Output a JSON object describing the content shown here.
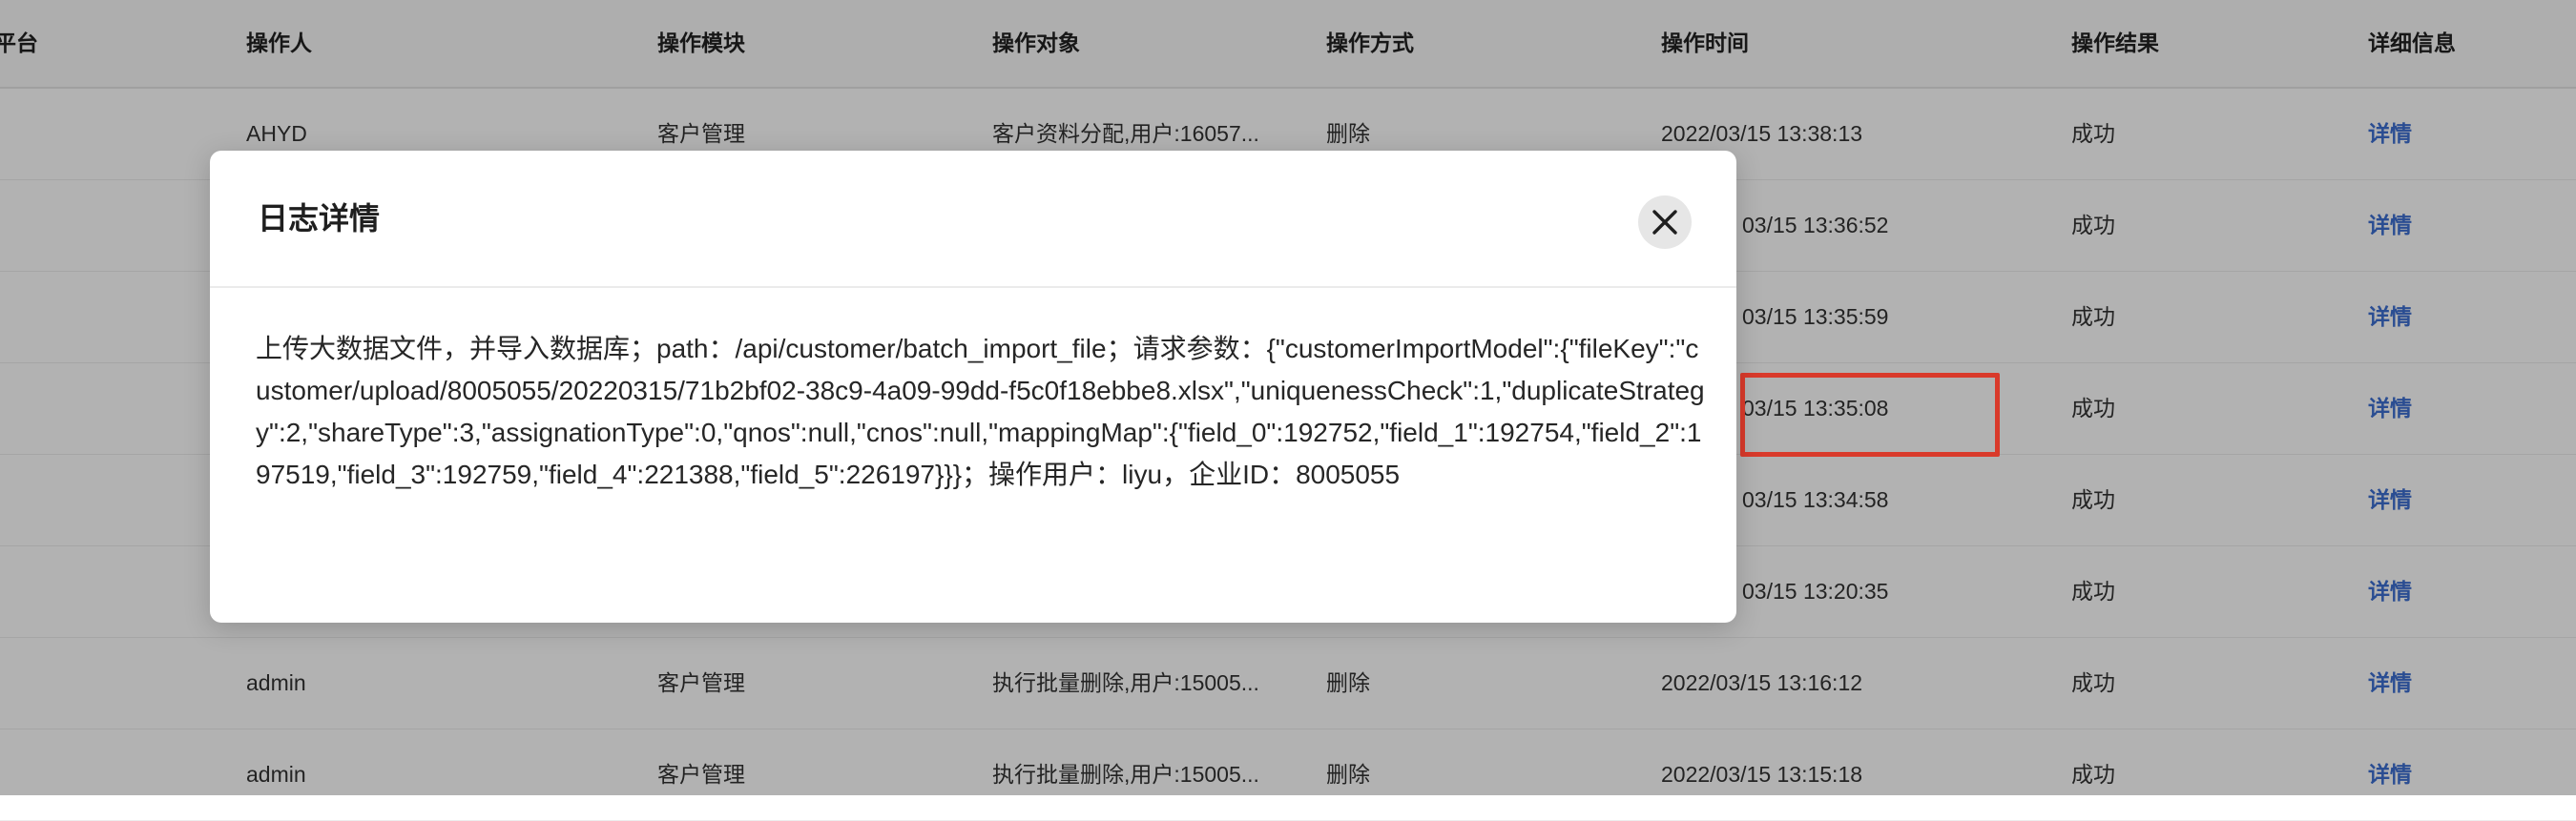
{
  "table": {
    "headers": [
      "平台",
      "操作人",
      "操作模块",
      "操作对象",
      "操作方式",
      "操作时间",
      "操作结果",
      "详细信息"
    ],
    "rows": [
      {
        "operator": "AHYD",
        "module": "客户管理",
        "target": "客户资料分配,用户:16057...",
        "method": "删除",
        "time": "2022/03/15 13:38:13",
        "result": "成功",
        "detail": "详情"
      },
      {
        "operator": "",
        "module": "",
        "target": "",
        "method": "",
        "time": "03/15 13:36:52",
        "result": "成功",
        "detail": "详情"
      },
      {
        "operator": "",
        "module": "",
        "target": "",
        "method": "",
        "time": "03/15 13:35:59",
        "result": "成功",
        "detail": "详情"
      },
      {
        "operator": "",
        "module": "",
        "target": "",
        "method": "",
        "time": "03/15 13:35:08",
        "result": "成功",
        "detail": "详情"
      },
      {
        "operator": "",
        "module": "",
        "target": "",
        "method": "",
        "time": "03/15 13:34:58",
        "result": "成功",
        "detail": "详情"
      },
      {
        "operator": "",
        "module": "",
        "target": "",
        "method": "",
        "time": "03/15 13:20:35",
        "result": "成功",
        "detail": "详情"
      },
      {
        "operator": "admin",
        "module": "客户管理",
        "target": "执行批量删除,用户:15005...",
        "method": "删除",
        "time": "2022/03/15 13:16:12",
        "result": "成功",
        "detail": "详情"
      },
      {
        "operator": "admin",
        "module": "客户管理",
        "target": "执行批量删除,用户:15005...",
        "method": "删除",
        "time": "2022/03/15 13:15:18",
        "result": "成功",
        "detail": "详情"
      }
    ]
  },
  "modal": {
    "title": "日志详情",
    "close_icon": "close-icon",
    "body": "上传大数据文件，并导入数据库；path：/api/customer/batch_import_file；请求参数：{\"customerImportModel\":{\"fileKey\":\"customer/upload/8005055/20220315/71b2bf02-38c9-4a09-99dd-f5c0f18ebbe8.xlsx\",\"uniquenessCheck\":1,\"duplicateStrategy\":2,\"shareType\":3,\"assignationType\":0,\"qnos\":null,\"cnos\":null,\"mappingMap\":{\"field_0\":192752,\"field_1\":192754,\"field_2\":197519,\"field_3\":192759,\"field_4\":221388,\"field_5\":226197}}}；操作用户：liyu，企业ID：8005055"
  },
  "colors": {
    "link": "#3d6fd1",
    "highlight": "#d93a2b",
    "mask": "rgba(0,0,0,0.30)"
  }
}
